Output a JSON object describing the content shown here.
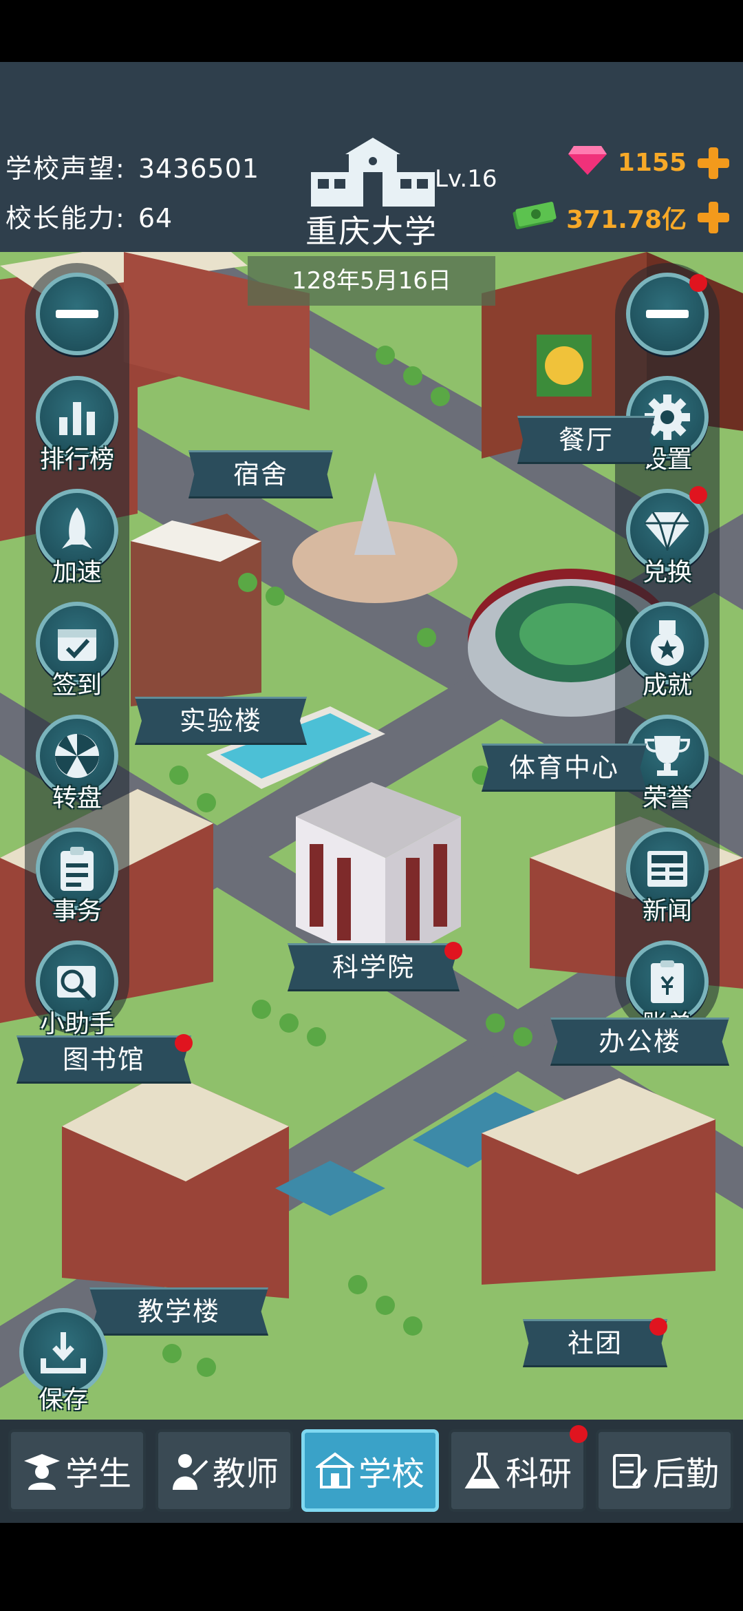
{
  "header": {
    "reputation_label": "学校声望:",
    "reputation_value": "3436501",
    "ability_label": "校长能力:",
    "ability_value": "64",
    "level": "Lv.16",
    "school_name": "重庆大学",
    "gems": "1155",
    "money": "371.78亿"
  },
  "date": "128年5月16日",
  "left_menu": [
    {
      "label": ""
    },
    {
      "label": "排行榜"
    },
    {
      "label": "加速"
    },
    {
      "label": "签到"
    },
    {
      "label": "转盘"
    },
    {
      "label": "事务"
    },
    {
      "label": "小助手"
    }
  ],
  "right_menu": [
    {
      "label": ""
    },
    {
      "label": "设置"
    },
    {
      "label": "兑换"
    },
    {
      "label": "成就"
    },
    {
      "label": "荣誉"
    },
    {
      "label": "新闻"
    },
    {
      "label": "账单"
    }
  ],
  "buildings": {
    "dorm": "宿舍",
    "canteen": "餐厅",
    "lab": "实验楼",
    "sports": "体育中心",
    "science": "科学院",
    "library": "图书馆",
    "office": "办公楼",
    "teaching": "教学楼",
    "club": "社团"
  },
  "save_label": "保存",
  "tabs": [
    {
      "label": "学生"
    },
    {
      "label": "教师"
    },
    {
      "label": "学校"
    },
    {
      "label": "科研"
    },
    {
      "label": "后勤"
    }
  ],
  "colors": {
    "topbar": "#2f3f4c",
    "accent_gold": "#f7a928",
    "tab_active": "#3aa2c8",
    "notify_dot": "#e0141f"
  }
}
